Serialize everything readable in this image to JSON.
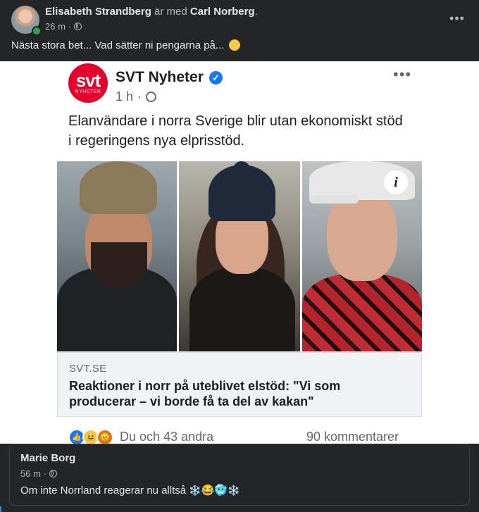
{
  "post": {
    "author": "Elisabeth Strandberg",
    "with_text": "är med",
    "tagged": "Carl Norberg",
    "time": "26 m",
    "text": "Nästa stora bet... Vad sätter ni pengarna på...",
    "emoji_icon": "smirk-emoji"
  },
  "shared": {
    "logo_text": "svt",
    "logo_subtext": "NYHETER",
    "source_name": "SVT Nyheter",
    "time": "1 h",
    "text": "Elanvändare i norra Sverige blir utan ekonomiskt stöd i regeringens nya elprisstöd.",
    "link_domain": "SVT.SE",
    "link_title": "Reaktioner i norr på uteblivet elstöd: \"Vi som producerar – vi borde få ta del av kakan\"",
    "info_label": "i",
    "reactions_text": "Du och 43 andra",
    "comments_text": "90 kommentarer",
    "reaction_icons": [
      "like-icon",
      "haha-icon",
      "angry-icon"
    ]
  },
  "comment": {
    "author": "Marie Borg",
    "time": "56 m",
    "text": "Om inte Norrland reagerar nu alltså",
    "emojis": [
      "snowflake",
      "laughing",
      "cold-face",
      "snowflake"
    ]
  },
  "colors": {
    "background": "#242526",
    "svt_red": "#e4002b",
    "verified_blue": "#1877f2",
    "online_green": "#31a24c"
  }
}
